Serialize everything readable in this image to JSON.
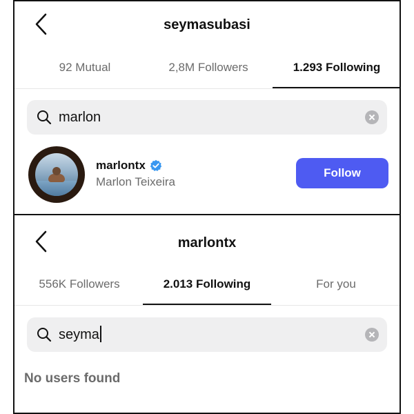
{
  "panel_top": {
    "title": "seymasubasi",
    "tabs": [
      {
        "label": "92 Mutual"
      },
      {
        "label": "2,8M Followers"
      },
      {
        "label": "1.293 Following"
      }
    ],
    "search": {
      "value": "marlon"
    },
    "result": {
      "username": "marlontx",
      "full_name": "Marlon Teixeira",
      "verified": true,
      "button_label": "Follow"
    }
  },
  "panel_bottom": {
    "title": "marlontx",
    "tabs": [
      {
        "label": "556K Followers"
      },
      {
        "label": "2.013 Following"
      },
      {
        "label": "For you"
      }
    ],
    "search": {
      "value": "seyma"
    },
    "empty_message": "No users found"
  },
  "colors": {
    "accent": "#4e5bf2",
    "verified": "#3897f0",
    "search_bg": "#efeff0",
    "muted_text": "#6b6b6b"
  }
}
